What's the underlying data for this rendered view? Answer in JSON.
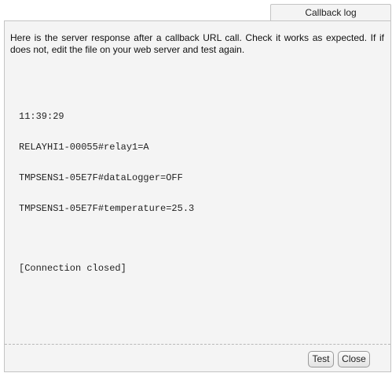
{
  "tab": {
    "label": "Callback log"
  },
  "intro_text": "Here is the server response after a callback URL call. Check it works as expected. If if does not, edit the file on your web server and test again.",
  "log": {
    "lines": [
      "11:39:29",
      "RELAYHI1-00055#relay1=A",
      "TMPSENS1-05E7F#dataLogger=OFF",
      "TMPSENS1-05E7F#temperature=25.3"
    ],
    "closing": "[Connection closed]"
  },
  "buttons": {
    "test_label": "Test",
    "close_label": "Close"
  }
}
